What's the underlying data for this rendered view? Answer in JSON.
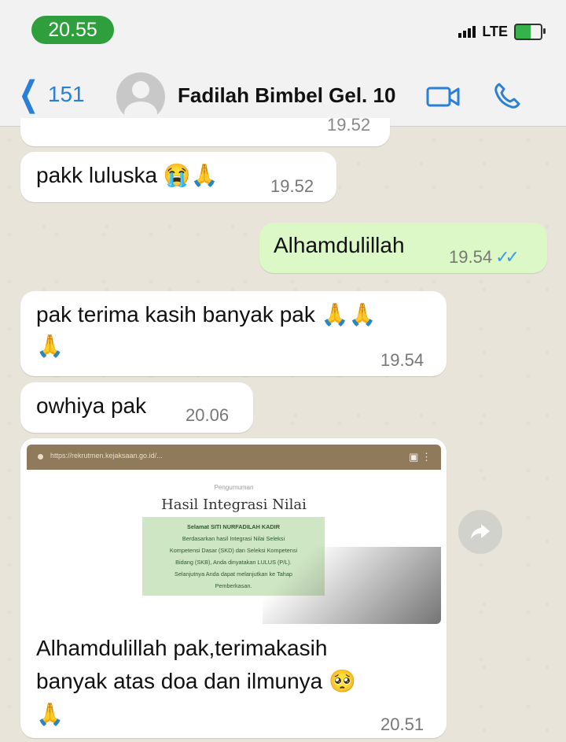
{
  "status_bar": {
    "time": "20.55",
    "network": "LTE"
  },
  "header": {
    "back_count": "151",
    "contact_name": "Fadilah Bimbel Gel. 10",
    "icons": [
      "chevron-left-icon",
      "avatar-icon",
      "video-call-icon",
      "phone-icon"
    ],
    "accent_color": "#2a7fd6"
  },
  "colors": {
    "incoming_bubble": "#ffffff",
    "outgoing_bubble": "#dcf8c6",
    "time_pill": "#2f9f3e",
    "read_ticks": "#3a9be6"
  },
  "messages": [
    {
      "direction": "in",
      "text": "",
      "time": "19.52"
    },
    {
      "direction": "in",
      "text": "pakk luluska 😭🙏",
      "time": "19.52"
    },
    {
      "direction": "out",
      "text": "Alhamdulillah",
      "time": "19.54",
      "status": "read"
    },
    {
      "direction": "in",
      "text": "pak terima kasih banyak pak 🙏🙏",
      "text_line2": "🙏",
      "time": "19.54"
    },
    {
      "direction": "in",
      "text": "owhiya pak",
      "time": "20.06"
    },
    {
      "direction": "in",
      "image": {
        "url": "https://rekrutmen.kejaksaan.go.id/...",
        "subheading": "Pengumuman",
        "title": "Hasil Integrasi Nilai",
        "box_lines": [
          "Selamat SITI NURFADILAH KADIR",
          "Berdasarkan hasil Integrasi Nilai Seleksi",
          "Kompetensi Dasar (SKD) dan Seleksi Kompetensi",
          "Bidang (SKB), Anda dinyatakan LULUS (P/L).",
          "Selanjutnya Anda dapat melanjutkan ke Tahap",
          "Pemberkasan."
        ]
      },
      "text": "Alhamdulillah pak,terimakasih",
      "text_line2": "banyak atas doa dan ilmunya 🥺",
      "text_line3": "🙏",
      "time": "20.51"
    }
  ]
}
